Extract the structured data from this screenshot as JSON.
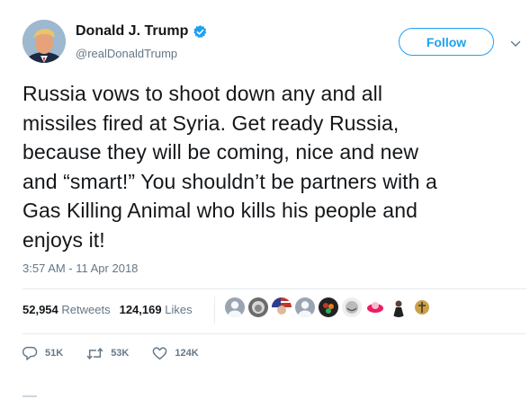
{
  "author": {
    "display_name": "Donald J. Trump",
    "handle": "@realDonaldTrump",
    "verified": true
  },
  "follow_button": {
    "label": "Follow"
  },
  "tweet": {
    "lines": [
      "Russia vows to shoot down any and all",
      "missiles fired at Syria. Get ready Russia,",
      "because they will be coming, nice and new",
      "and “smart!” You shouldn’t be partners with a",
      "Gas Killing Animal who kills his people and",
      "enjoys it!"
    ],
    "timestamp": "3:57 AM - 11 Apr 2018"
  },
  "stats": {
    "retweets_count": "52,954",
    "retweets_label": "Retweets",
    "likes_count": "124,169",
    "likes_label": "Likes"
  },
  "actions": {
    "reply_count": "51K",
    "retweet_count": "53K",
    "like_count": "124K"
  },
  "colors": {
    "accent": "#1da1f2",
    "muted": "#657786",
    "text": "#14171a",
    "divider": "#e6ecf0"
  },
  "icons": [
    "verified-badge-icon",
    "chevron-down-icon",
    "reply-icon",
    "retweet-icon",
    "like-heart-icon"
  ]
}
